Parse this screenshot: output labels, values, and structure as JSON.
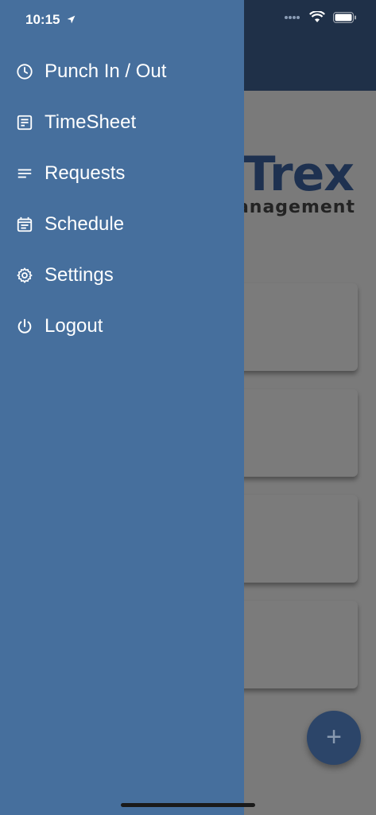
{
  "status_bar": {
    "time": "10:15"
  },
  "background_app": {
    "logo_text": "Trex",
    "logo_subtitle": "Management",
    "fab_label": "+"
  },
  "drawer": {
    "items": [
      {
        "label": "Punch In / Out",
        "icon": "clock-icon"
      },
      {
        "label": "TimeSheet",
        "icon": "timesheet-icon"
      },
      {
        "label": "Requests",
        "icon": "list-icon"
      },
      {
        "label": "Schedule",
        "icon": "calendar-icon"
      },
      {
        "label": "Settings",
        "icon": "gear-icon"
      },
      {
        "label": "Logout",
        "icon": "power-icon"
      }
    ]
  },
  "colors": {
    "drawer_bg": "#466f9d",
    "header_bg": "#1f3048",
    "fab_bg": "#2c4569"
  }
}
